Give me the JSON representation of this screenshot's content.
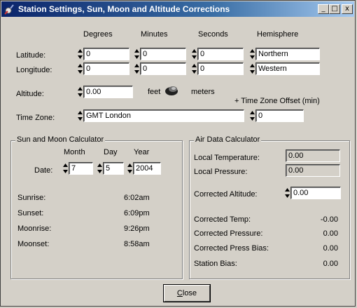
{
  "window": {
    "title": "Station Settings, Sun, Moon and Altitude Corrections",
    "minimize_glyph": "_",
    "maximize_glyph": "□",
    "close_glyph": "x"
  },
  "headers": {
    "degrees": "Degrees",
    "minutes": "Minutes",
    "seconds": "Seconds",
    "hemisphere": "Hemisphere"
  },
  "latitude": {
    "label": "Latitude:",
    "degrees": "0",
    "minutes": "0",
    "seconds": "0",
    "hemisphere": "Northern"
  },
  "longitude": {
    "label": "Longitude:",
    "degrees": "0",
    "minutes": "0",
    "seconds": "0",
    "hemisphere": "Western"
  },
  "altitude": {
    "label": "Altitude:",
    "value": "0.00",
    "unit_feet": "feet",
    "unit_meters": "meters"
  },
  "timezone": {
    "label": "Time Zone:",
    "value": "GMT London",
    "offset_label": "+ Time Zone Offset (min)",
    "offset_value": "0"
  },
  "sun_moon": {
    "title": "Sun and Moon Calculator",
    "month_label": "Month",
    "day_label": "Day",
    "year_label": "Year",
    "date_label": "Date:",
    "month": "7",
    "day": "5",
    "year": "2004",
    "sunrise_label": "Sunrise:",
    "sunrise": "6:02am",
    "sunset_label": "Sunset:",
    "sunset": "6:09pm",
    "moonrise_label": "Moonrise:",
    "moonrise": "9:26pm",
    "moonset_label": "Moonset:",
    "moonset": "8:58am"
  },
  "air": {
    "title": "Air Data Calculator",
    "local_temp_label": "Local Temperature:",
    "local_temp": "0.00",
    "local_pressure_label": "Local Pressure:",
    "local_pressure": "0.00",
    "corrected_alt_label": "Corrected Altitude:",
    "corrected_alt": "0.00",
    "corrected_temp_label": "Corrected Temp:",
    "corrected_temp": "-0.00",
    "corrected_pressure_label": "Corrected Pressure:",
    "corrected_pressure": "0.00",
    "corrected_press_bias_label": "Corrected Press Bias:",
    "corrected_press_bias": "0.00",
    "station_bias_label": "Station Bias:",
    "station_bias": "0.00"
  },
  "close_button": {
    "mnemonic": "C",
    "rest": "lose"
  },
  "icons": {
    "app": "satellite-dish-icon",
    "spinner": "spinner-arrows-icon",
    "toggle": "unit-toggle-knob-icon"
  }
}
